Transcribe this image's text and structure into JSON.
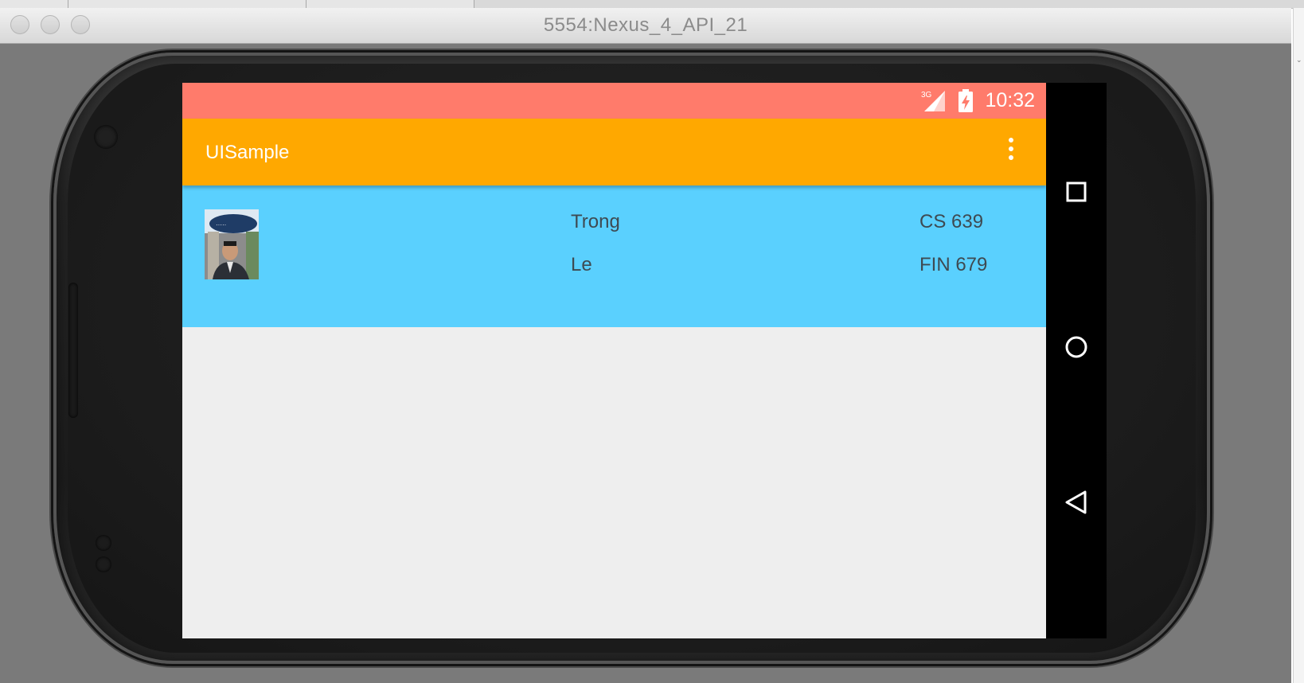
{
  "host_window": {
    "title": "5554:Nexus_4_API_21"
  },
  "status_bar": {
    "network_label": "3G",
    "time": "10:32",
    "color": "#ff7b6b"
  },
  "app_bar": {
    "title": "UISample",
    "color": "#ffa800",
    "overflow_icon": "more-vert-icon"
  },
  "list_item": {
    "color": "#5ad0fe",
    "first_name": "Trong",
    "last_name": "Le",
    "course_1": "CS 639",
    "course_2": "FIN 679",
    "photo_icon": "profile-photo"
  },
  "nav_bar": {
    "buttons": [
      "recents-square-icon",
      "home-circle-icon",
      "back-triangle-icon"
    ]
  }
}
